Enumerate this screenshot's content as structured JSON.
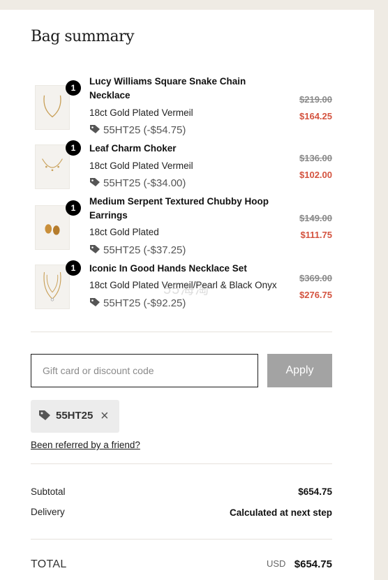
{
  "page": {
    "title": "Bag summary",
    "watermark": "55海淘"
  },
  "items": [
    {
      "qty": "1",
      "name": "Lucy Williams Square Snake Chain Necklace",
      "variant": "18ct Gold Plated Vermeil",
      "promo": "55HT25 (-$54.75)",
      "price_old": "$219.00",
      "price_new": "$164.25"
    },
    {
      "qty": "1",
      "name": "Leaf Charm Choker",
      "variant": "18ct Gold Plated Vermeil",
      "promo": "55HT25 (-$34.00)",
      "price_old": "$136.00",
      "price_new": "$102.00"
    },
    {
      "qty": "1",
      "name": "Medium Serpent Textured Chubby Hoop Earrings",
      "variant": "18ct Gold Plated",
      "promo": "55HT25 (-$37.25)",
      "price_old": "$149.00",
      "price_new": "$111.75"
    },
    {
      "qty": "1",
      "name": "Iconic In Good Hands Necklace Set",
      "variant": "18ct Gold Plated Vermeil/Pearl & Black Onyx",
      "promo": "55HT25 (-$92.25)",
      "price_old": "$369.00",
      "price_new": "$276.75"
    }
  ],
  "discount": {
    "placeholder": "Gift card or discount code",
    "value": "",
    "apply_label": "Apply",
    "applied_code": "55HT25",
    "remove_symbol": "×"
  },
  "referral_link": "Been referred by a friend?",
  "summary": {
    "subtotal_label": "Subtotal",
    "subtotal_value": "$654.75",
    "delivery_label": "Delivery",
    "delivery_value": "Calculated at next step",
    "total_label": "TOTAL",
    "currency": "USD",
    "total_value": "$654.75"
  },
  "colors": {
    "background": "#efebe4",
    "sale_price": "#d4533f",
    "apply_button": "#a3a3a3"
  },
  "icons": [
    "tag-icon",
    "close-icon"
  ]
}
